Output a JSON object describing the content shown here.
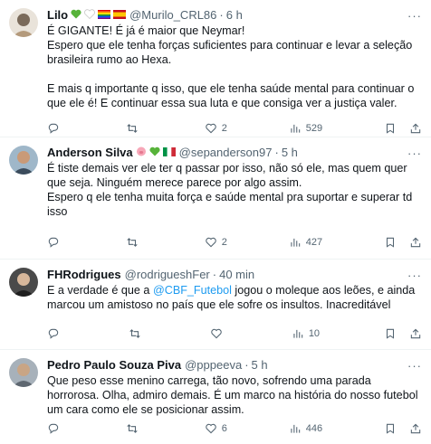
{
  "tweets": [
    {
      "name": "Lilo",
      "emojis": [
        "green-heart",
        "white-heart",
        "rainbow-flag",
        "spain-flag"
      ],
      "handle": "@Murilo_CRL86",
      "dot": "·",
      "time": "6 h",
      "text": "É GIGANTE! É já é maior que Neymar!\nEspero que ele tenha forças suficientes para continuar e levar a seleção brasileira rumo ao Hexa.\n\nE mais q importante q isso, que ele tenha saúde mental para continuar o que ele é! E continuar essa sua luta e que consiga ver a justiça valer.",
      "replies": "",
      "retweets": "",
      "likes": "2",
      "views": "529"
    },
    {
      "name": "Anderson Silva",
      "emojis": [
        "pig-face",
        "green-heart",
        "italy-flag"
      ],
      "handle": "@sepanderson97",
      "dot": "·",
      "time": "5 h",
      "text": "É tiste demais ver ele ter q passar por isso, não só ele, mas quem quer que seja. Ninguém merece parece por algo assim.\nEspero q ele tenha muita força e saúde mental pra suportar e superar td isso",
      "replies": "",
      "retweets": "",
      "likes": "2",
      "views": "427"
    },
    {
      "name": "FHRodrigues",
      "emojis": [],
      "handle": "@rodrigueshFer",
      "dot": "·",
      "time": "40 min",
      "text_before": "E a verdade é que a ",
      "mention": "@CBF_Futebol",
      "text_after": " jogou o moleque aos leões, e ainda marcou um amistoso no país que ele sofre os insultos. Inacreditável",
      "replies": "",
      "retweets": "",
      "likes": "",
      "views": "10"
    },
    {
      "name": "Pedro Paulo Souza Piva",
      "emojis": [],
      "handle": "@pppeeva",
      "dot": "·",
      "time": "5 h",
      "text": "Que peso esse menino carrega, tão novo, sofrendo uma parada horrorosa. Olha, admiro demais. É um marco na história do nosso futebol um cara como ele se posicionar assim.",
      "replies": "",
      "retweets": "",
      "likes": "6",
      "views": "446"
    }
  ],
  "more_label": "···",
  "colors": {
    "link": "#1d9bf0",
    "muted": "#536471",
    "divider": "#eff3f4"
  }
}
